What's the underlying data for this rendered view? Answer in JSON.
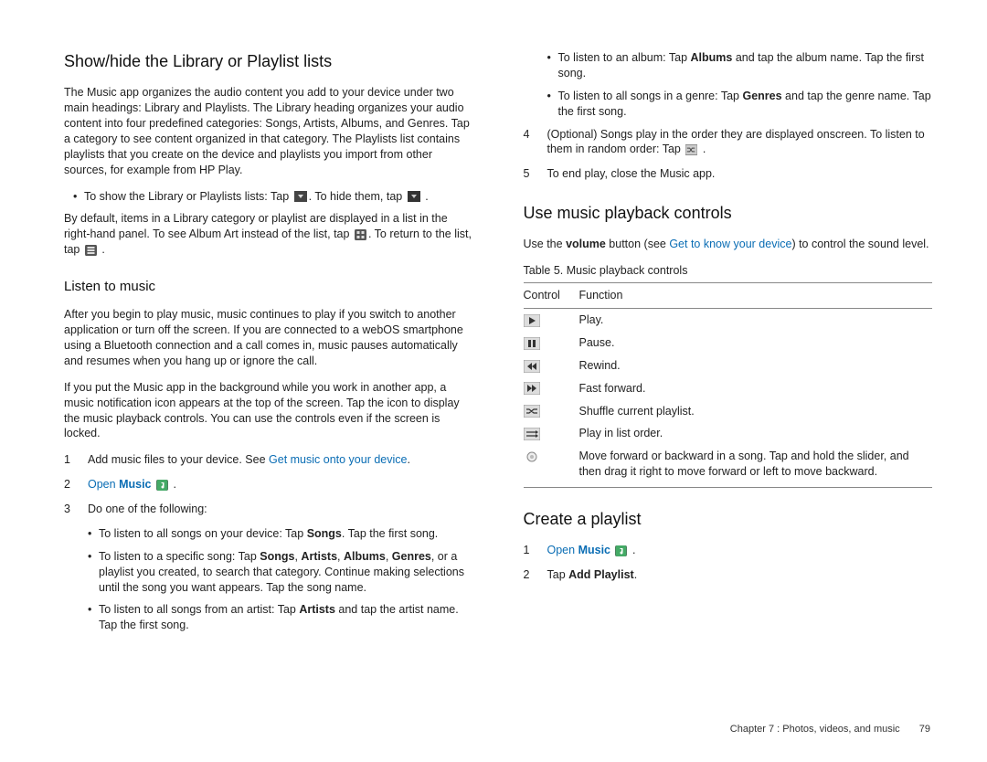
{
  "left": {
    "h_showhide": "Show/hide the Library or Playlist lists",
    "p1": "The Music app organizes the audio content you add to your device under two main headings: Library and Playlists. The Library heading organizes your audio content into four predefined categories: Songs, Artists, Albums, and Genres. Tap a category to see content organized in that category. The Playlists list contains playlists that you create on the device and playlists you import from other sources, for example from HP Play.",
    "bul1a": "To show the Library or Playlists lists: Tap ",
    "bul1b": ". To hide them, tap ",
    "bul1c": " .",
    "p2a": "By default, items in a Library category or playlist are displayed in a list in the right-hand panel. To see Album Art instead of the list, tap ",
    "p2b": ". To return to the list, tap ",
    "p2c": " .",
    "h_listen": "Listen to music",
    "p3": "After you begin to play music, music continues to play if you switch to another application or turn off the screen. If you are connected to a webOS smartphone using a Bluetooth connection and a call comes in, music pauses automatically and resumes when you hang up or ignore the call.",
    "p4": "If you put the Music app in the background while you work in another app, a music notification icon appears at the top of the screen. Tap the icon to display the music playback controls. You can use the controls even if the screen is locked.",
    "step1a": "Add music files to your device. See ",
    "step1link": "Get music onto your device",
    "step1b": ".",
    "step2a": "Open ",
    "step2bold": "Music",
    "step2b": " .",
    "step3": "Do one of the following:",
    "sb1a": "To listen to all songs on your device: Tap ",
    "sb1bold": "Songs",
    "sb1b": ". Tap the first song.",
    "sb2a": "To listen to a specific song: Tap ",
    "sb2s": "Songs",
    "sb2c": ", ",
    "sb2ar": "Artists",
    "sb2al": "Albums",
    "sb2g": "Genres",
    "sb2end": ", or a playlist you created, to search that category. Continue making selections until the song you want appears. Tap the song name.",
    "sb3a": "To listen to all songs from an artist: Tap ",
    "sb3bold": "Artists",
    "sb3b": " and tap the artist name. Tap the first song."
  },
  "right": {
    "sb4a": "To listen to an album: Tap ",
    "sb4bold": "Albums",
    "sb4b": " and tap the album name. Tap the first song.",
    "sb5a": "To listen to all songs in a genre: Tap ",
    "sb5bold": "Genres",
    "sb5b": " and tap the genre name. Tap the first song.",
    "step4a": "(Optional) Songs play in the order they are displayed onscreen. To listen to them in random order: Tap ",
    "step4b": " .",
    "step5": "To end play, close the Music app.",
    "h_controls": "Use music playback controls",
    "pc1a": "Use the ",
    "pc1bold": "volume",
    "pc1b": " button (see ",
    "pc1link": "Get to know your device",
    "pc1c": ") to control the sound level.",
    "tablecap": "Table 5.  Music playback controls",
    "th1": "Control",
    "th2": "Function",
    "r1": "Play.",
    "r2": "Pause.",
    "r3": "Rewind.",
    "r4": "Fast forward.",
    "r5": "Shuffle current playlist.",
    "r6": "Play in list order.",
    "r7": "Move forward or backward in a song. Tap and hold the slider, and then drag it right to move forward or left to move backward.",
    "h_create": "Create a playlist",
    "cp1a": "Open ",
    "cp1bold": "Music",
    "cp1b": " .",
    "cp2a": "Tap ",
    "cp2bold": "Add Playlist",
    "cp2b": "."
  },
  "footer": {
    "chapter": "Chapter 7 : Photos, videos, and music",
    "page": "79"
  }
}
